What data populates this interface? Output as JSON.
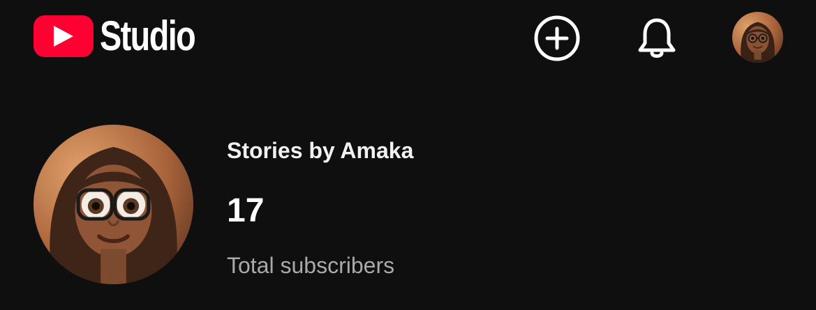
{
  "header": {
    "logo_text": "Studio",
    "icons": [
      "youtube-play-icon",
      "create-plus-icon",
      "bell-icon"
    ],
    "brand_color": "#ff0033"
  },
  "channel": {
    "name": "Stories by Amaka",
    "subscriber_count": "17",
    "subscriber_label": "Total subscribers"
  },
  "colors": {
    "background": "#0f0f0f",
    "text_primary": "#ffffff",
    "text_secondary": "#aaaaaa"
  }
}
